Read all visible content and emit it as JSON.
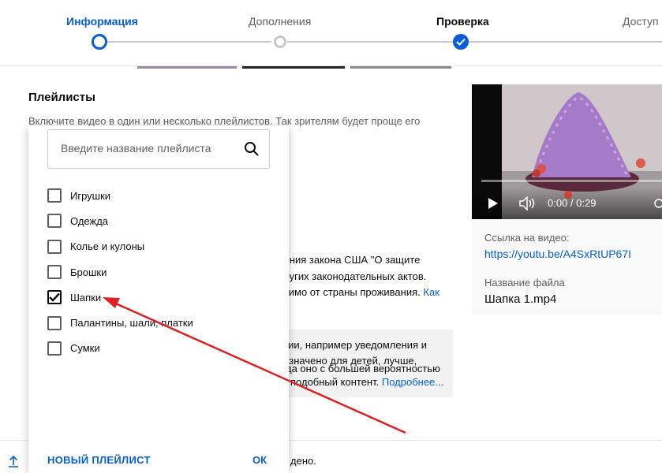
{
  "stepper": {
    "steps": [
      {
        "label": "Информация",
        "state": "done"
      },
      {
        "label": "Дополнения",
        "state": "todo"
      },
      {
        "label": "Проверка",
        "state": "current"
      },
      {
        "label": "Доступ",
        "state": "todo"
      }
    ]
  },
  "main": {
    "section_title": "Плейлисты",
    "section_desc": "Включите видео в один или несколько плейлистов. Так зрителям будет проще его",
    "bg_lines": [
      "дения закона США \"О защите",
      "других законодательных актов.",
      "исимо от страны проживания.",
      "кции, например уведомления и",
      "назначено для детей, лучше,",
      "да оно с большей вероятностью",
      "подобный контент."
    ],
    "bg_link_1": "Как",
    "bg_link_2": "Подробнее...",
    "bottom_text": "дено."
  },
  "video": {
    "time": "0:00 / 0:29",
    "link_label": "Ссылка на видео:",
    "link_url": "https://youtu.be/A4SxRtUP67I",
    "file_label": "Название файла",
    "file_name": "Шапка 1.mp4"
  },
  "playlist_popup": {
    "search_placeholder": "Введите название плейлиста",
    "items": [
      {
        "label": "Игрушки",
        "checked": false
      },
      {
        "label": "Одежда",
        "checked": false
      },
      {
        "label": "Колье и кулоны",
        "checked": false
      },
      {
        "label": "Брошки",
        "checked": false
      },
      {
        "label": "Шапки",
        "checked": true
      },
      {
        "label": "Палантины, шали, платки",
        "checked": false
      },
      {
        "label": "Сумки",
        "checked": false
      }
    ],
    "new_playlist_label": "НОВЫЙ ПЛЕЙЛИСТ",
    "ok_label": "ОК"
  },
  "colors": {
    "accent": "#065fd4",
    "annotation_arrow": "#e02020"
  }
}
